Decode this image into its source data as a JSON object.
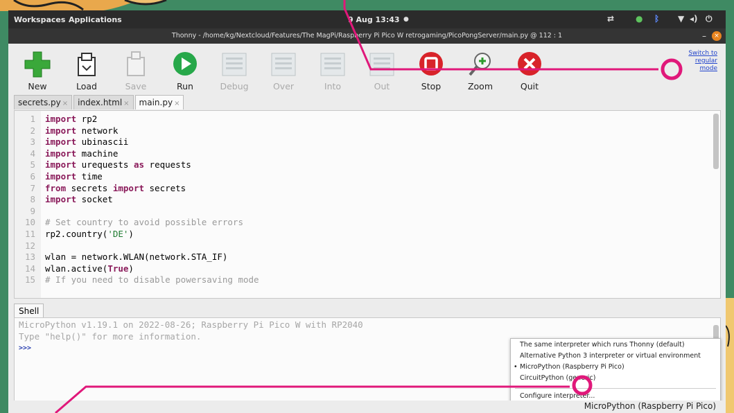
{
  "topbar": {
    "menus": [
      "Workspaces",
      "Applications"
    ],
    "clock": "9 Aug 13:43",
    "tray_icons": [
      "network-icon",
      "volume-icon",
      "bluetooth-icon",
      "wifi-icon",
      "speaker-icon",
      "power-icon"
    ]
  },
  "window": {
    "title": "Thonny - /home/kg/Nextcloud/Features/The MagPi/Raspberry Pi Pico W retrogaming/PicoPongServer/main.py @ 112 : 1",
    "minimize": "–",
    "close": "×"
  },
  "toolbar": {
    "buttons": [
      {
        "label": "New",
        "icon": "new-file-icon",
        "enabled": true
      },
      {
        "label": "Load",
        "icon": "load-icon",
        "enabled": true
      },
      {
        "label": "Save",
        "icon": "save-icon",
        "enabled": false
      },
      {
        "label": "Run",
        "icon": "run-icon",
        "enabled": true
      },
      {
        "label": "Debug",
        "icon": "debug-icon",
        "enabled": false
      },
      {
        "label": "Over",
        "icon": "step-over-icon",
        "enabled": false
      },
      {
        "label": "Into",
        "icon": "step-into-icon",
        "enabled": false
      },
      {
        "label": "Out",
        "icon": "step-out-icon",
        "enabled": false
      },
      {
        "label": "Stop",
        "icon": "stop-icon",
        "enabled": true
      },
      {
        "label": "Zoom",
        "icon": "zoom-icon",
        "enabled": true
      },
      {
        "label": "Quit",
        "icon": "quit-icon",
        "enabled": true
      }
    ],
    "switch_mode": [
      "Switch to",
      "regular",
      "mode"
    ]
  },
  "tabs": [
    {
      "label": "secrets.py",
      "close": "×",
      "active": false
    },
    {
      "label": "index.html",
      "close": "×",
      "active": false
    },
    {
      "label": "main.py",
      "close": "×",
      "active": true
    }
  ],
  "editor": {
    "lines": [
      {
        "n": "1",
        "parts": [
          [
            "kw",
            "import"
          ],
          [
            "plain",
            " rp2"
          ]
        ]
      },
      {
        "n": "2",
        "parts": [
          [
            "kw",
            "import"
          ],
          [
            "plain",
            " network"
          ]
        ]
      },
      {
        "n": "3",
        "parts": [
          [
            "kw",
            "import"
          ],
          [
            "plain",
            " ubinascii"
          ]
        ]
      },
      {
        "n": "4",
        "parts": [
          [
            "kw",
            "import"
          ],
          [
            "plain",
            " machine"
          ]
        ]
      },
      {
        "n": "5",
        "parts": [
          [
            "kw",
            "import"
          ],
          [
            "plain",
            " urequests "
          ],
          [
            "kw",
            "as"
          ],
          [
            "plain",
            " requests"
          ]
        ]
      },
      {
        "n": "6",
        "parts": [
          [
            "kw",
            "import"
          ],
          [
            "plain",
            " time"
          ]
        ]
      },
      {
        "n": "7",
        "parts": [
          [
            "kw",
            "from"
          ],
          [
            "plain",
            " secrets "
          ],
          [
            "kw",
            "import"
          ],
          [
            "plain",
            " secrets"
          ]
        ]
      },
      {
        "n": "8",
        "parts": [
          [
            "kw",
            "import"
          ],
          [
            "plain",
            " socket"
          ]
        ]
      },
      {
        "n": "9",
        "parts": []
      },
      {
        "n": "10",
        "parts": [
          [
            "cm",
            "# Set country to avoid possible errors"
          ]
        ]
      },
      {
        "n": "11",
        "parts": [
          [
            "plain",
            "rp2.country("
          ],
          [
            "str",
            "'DE'"
          ],
          [
            "plain",
            ")"
          ]
        ]
      },
      {
        "n": "12",
        "parts": []
      },
      {
        "n": "13",
        "parts": [
          [
            "plain",
            "wlan = network.WLAN(network.STA_IF)"
          ]
        ]
      },
      {
        "n": "14",
        "parts": [
          [
            "plain",
            "wlan.active("
          ],
          [
            "kw",
            "True"
          ],
          [
            "plain",
            ")"
          ]
        ]
      },
      {
        "n": "15",
        "parts": [
          [
            "cm",
            "# If you need to disable powersaving mode"
          ]
        ]
      }
    ]
  },
  "shell": {
    "tab_label": "Shell",
    "banner_1": "MicroPython v1.19.1 on 2022-08-26; Raspberry Pi Pico W with RP2040",
    "banner_2": "Type \"help()\" for more information.",
    "prompt": ">>>"
  },
  "interpreter_menu": {
    "items": [
      {
        "label": "The same interpreter which runs Thonny (default)",
        "selected": false
      },
      {
        "label": "Alternative Python 3 interpreter or virtual environment",
        "selected": false
      },
      {
        "label": "MicroPython (Raspberry Pi Pico)",
        "selected": true
      },
      {
        "label": "CircuitPython (generic)",
        "selected": false
      }
    ],
    "configure": "Configure interpreter..."
  },
  "status": {
    "interpreter": "MicroPython (Raspberry Pi Pico)"
  },
  "colors": {
    "background_green": "#3f8a63",
    "annotation_pink": "#e0187a",
    "run_green": "#27a84a",
    "stop_red": "#d8232a"
  }
}
